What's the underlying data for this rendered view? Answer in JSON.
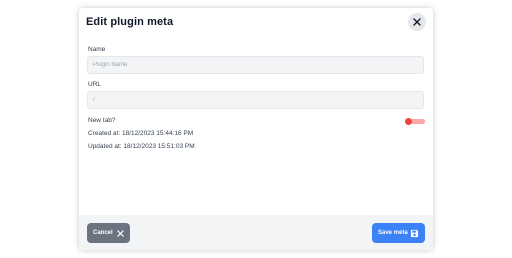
{
  "dialog": {
    "title": "Edit plugin meta",
    "close_icon": "close-icon"
  },
  "form": {
    "name": {
      "label": "Name",
      "placeholder": "Plugin Name",
      "value": ""
    },
    "url": {
      "label": "URL",
      "placeholder": "/",
      "value": ""
    },
    "new_tab": {
      "label": "New tab?",
      "checked": false
    }
  },
  "meta": {
    "created": "Created at: 18/12/2023 15:44:16 PM",
    "updated": "Updated at: 18/12/2023 15:51:03 PM"
  },
  "footer": {
    "cancel_label": "Cancel",
    "cancel_icon": "x-icon",
    "save_label": "Save meta",
    "save_icon": "floppy-disk-icon"
  },
  "colors": {
    "primary": "#3b82f6",
    "secondary": "#6b7280",
    "toggle_accent": "#ef4444"
  }
}
